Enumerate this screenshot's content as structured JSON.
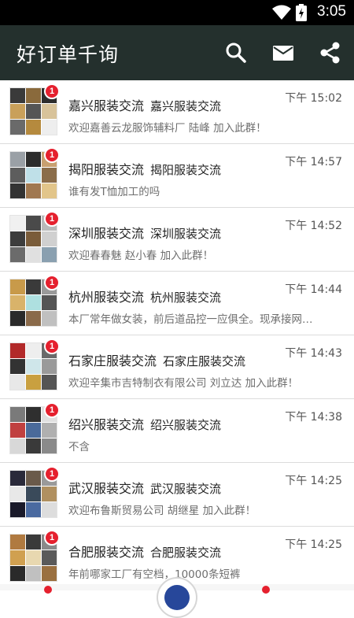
{
  "status_bar": {
    "time": "3:05"
  },
  "app_bar": {
    "title": "好订单千询",
    "icons": [
      "search-icon",
      "mail-icon",
      "share-icon"
    ]
  },
  "colors": {
    "app_bar": "#24302d",
    "badge": "#e5202e",
    "status_bar": "#000000"
  },
  "conversations": [
    {
      "title": "嘉兴服装交流",
      "subtitle": "嘉兴服装交流",
      "time": "下午 15:02",
      "preview": "欢迎嘉善云龙服饰辅料厂 陆峰 加入此群！",
      "badge": "1"
    },
    {
      "title": "揭阳服装交流",
      "subtitle": "揭阳服装交流",
      "time": "下午 14:57",
      "preview": "谁有发T恤加工的吗",
      "badge": "1"
    },
    {
      "title": "深圳服装交流",
      "subtitle": "深圳服装交流",
      "time": "下午 14:52",
      "preview": "欢迎春春魅 赵小春 加入此群！",
      "badge": "1"
    },
    {
      "title": "杭州服装交流",
      "subtitle": "杭州服装交流",
      "time": "下午 14:44",
      "preview": "本厂常年做女装，前后道品控一应俱全。现承接网…",
      "badge": "1"
    },
    {
      "title": "石家庄服装交流",
      "subtitle": "石家庄服装交流",
      "time": "下午 14:43",
      "preview": "欢迎辛集市吉特制衣有限公司 刘立达 加入此群！",
      "badge": "1"
    },
    {
      "title": "绍兴服装交流",
      "subtitle": "绍兴服装交流",
      "time": "下午 14:38",
      "preview": "不含",
      "badge": "1"
    },
    {
      "title": "武汉服装交流",
      "subtitle": "武汉服装交流",
      "time": "下午 14:25",
      "preview": "欢迎布鲁斯贸易公司 胡继星 加入此群！",
      "badge": "1"
    },
    {
      "title": "合肥服装交流",
      "subtitle": "合肥服装交流",
      "time": "下午 14:25",
      "preview": "年前哪家工厂有空档，10000条短裤",
      "badge": "1"
    }
  ]
}
